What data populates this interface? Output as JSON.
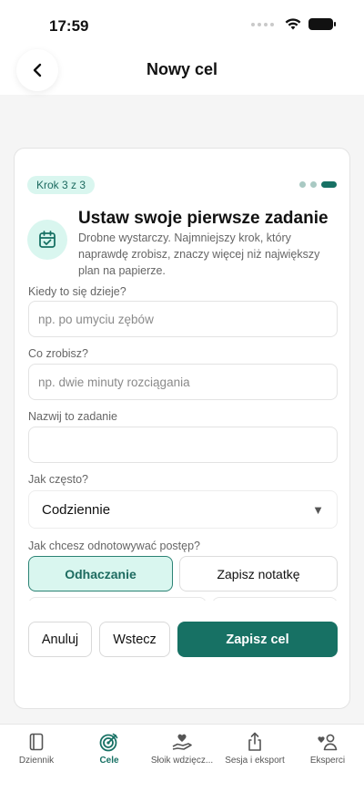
{
  "status_bar": {
    "time": "17:59"
  },
  "header": {
    "title": "Nowy cel"
  },
  "wizard": {
    "step_label": "Krok 3 z 3",
    "heading": "Ustaw swoje pierwsze zadanie",
    "subtitle": "Drobne wystarczy. Najmniejszy krok, który naprawdę zrobisz, znaczy więcej niż największy plan na papierze."
  },
  "form": {
    "when": {
      "label": "Kiedy to się dzieje?",
      "placeholder": "np. po umyciu zębów",
      "value": ""
    },
    "what": {
      "label": "Co zrobisz?",
      "placeholder": "np. dwie minuty rozciągania",
      "value": ""
    },
    "name": {
      "label": "Nazwij to zadanie",
      "placeholder": "",
      "value": ""
    },
    "frequency": {
      "label": "Jak często?",
      "selected": "Codziennie"
    },
    "tracking": {
      "label": "Jak chcesz odnotowywać postęp?",
      "options": [
        "Odhaczanie",
        "Zapisz notatkę"
      ],
      "selected": "Odhaczanie"
    }
  },
  "actions": {
    "cancel": "Anuluj",
    "back": "Wstecz",
    "save": "Zapisz cel"
  },
  "tabs": [
    {
      "label": "Dziennik",
      "icon": "book-icon"
    },
    {
      "label": "Cele",
      "icon": "target-icon"
    },
    {
      "label": "Słoik wdzięcz...",
      "icon": "heart-hand-icon"
    },
    {
      "label": "Sesja i eksport",
      "icon": "share-icon"
    },
    {
      "label": "Eksperci",
      "icon": "people-icon"
    }
  ],
  "colors": {
    "accent": "#177164",
    "accent_light": "#d9f6ef"
  }
}
